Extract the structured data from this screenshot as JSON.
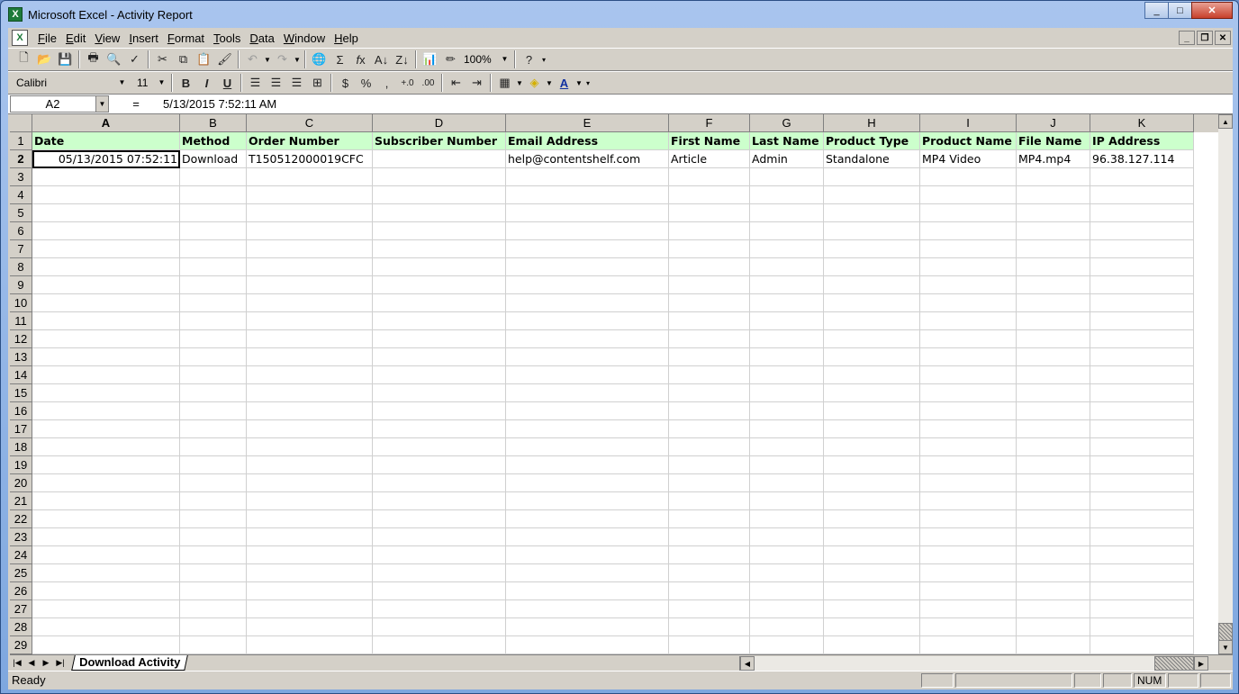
{
  "window": {
    "title": "Microsoft Excel - Activity Report"
  },
  "menu": [
    "File",
    "Edit",
    "View",
    "Insert",
    "Format",
    "Tools",
    "Data",
    "Window",
    "Help"
  ],
  "toolbar": {
    "zoom": "100%"
  },
  "format": {
    "font": "Calibri",
    "size": "11"
  },
  "formula": {
    "cell_ref": "A2",
    "equals": "=",
    "value": "5/13/2015  7:52:11 AM"
  },
  "columns": [
    "A",
    "B",
    "C",
    "D",
    "E",
    "F",
    "G",
    "H",
    "I",
    "J",
    "K"
  ],
  "headers": [
    "Date",
    "Method",
    "Order Number",
    "Subscriber Number",
    "Email Address",
    "First Name",
    "Last Name",
    "Product Type",
    "Product Name",
    "File Name",
    "IP Address"
  ],
  "row2": [
    "05/13/2015 07:52:11",
    "Download",
    "T150512000019CFC",
    "",
    "help@contentshelf.com",
    "Article",
    "Admin",
    "Standalone",
    "MP4 Video",
    "MP4.mp4",
    "96.38.127.114"
  ],
  "sheet": {
    "tab": "Download Activity"
  },
  "status": {
    "text": "Ready",
    "num": "NUM"
  }
}
